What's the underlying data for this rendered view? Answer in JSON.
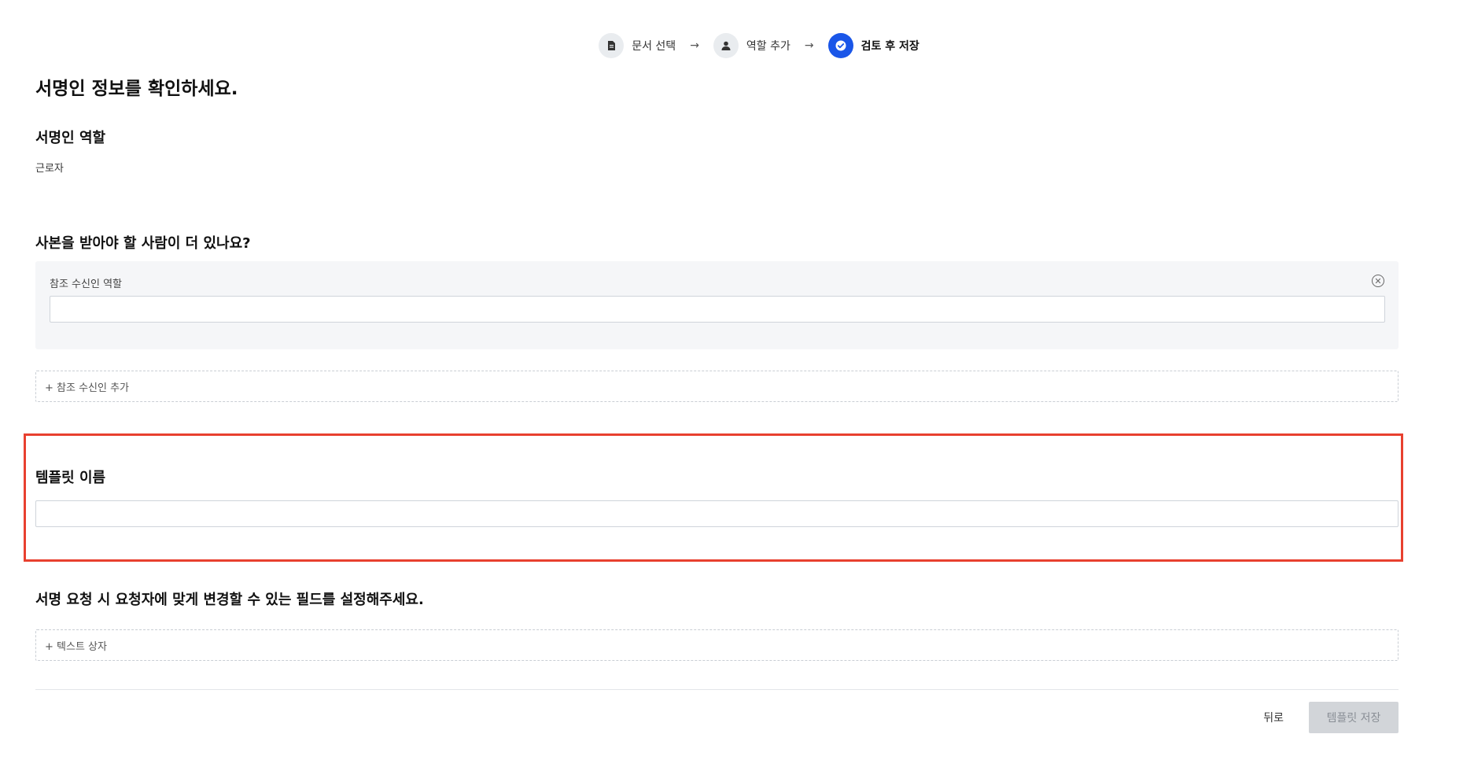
{
  "stepper": {
    "steps": [
      {
        "label": "문서 선택",
        "icon": "document-icon",
        "active": false
      },
      {
        "label": "역할 추가",
        "icon": "person-icon",
        "active": false
      },
      {
        "label": "검토 후 저장",
        "icon": "check-circle-icon",
        "active": true
      }
    ],
    "arrow": "→",
    "active_color": "#1a56e8"
  },
  "page": {
    "title": "서명인 정보를 확인하세요."
  },
  "signer_role": {
    "heading": "서명인 역할",
    "value": "근로자"
  },
  "cc": {
    "heading": "사본을 받아야 할 사람이 더 있나요?",
    "field_label": "참조 수신인 역할",
    "field_value": "",
    "clear_icon": "close-circle-icon",
    "add_label": "+ 참조 수신인 추가"
  },
  "template_name": {
    "heading": "템플릿 이름",
    "value": "",
    "highlight_color": "#e8402f"
  },
  "fields": {
    "heading": "서명 요청 시 요청자에 맞게 변경할 수 있는 필드를 설정해주세요.",
    "add_label": "+ 텍스트 상자"
  },
  "footer": {
    "back_label": "뒤로",
    "save_label": "템플릿 저장"
  }
}
